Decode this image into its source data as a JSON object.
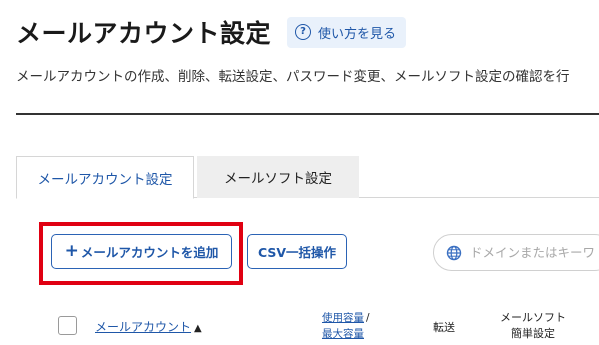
{
  "header": {
    "title": "メールアカウント設定",
    "help_label": "使い方を見る",
    "help_icon": "?",
    "description": "メールアカウントの作成、削除、転送設定、パスワード変更、メールソフト設定の確認を行"
  },
  "tabs": [
    {
      "label": "メールアカウント設定",
      "active": true
    },
    {
      "label": "メールソフト設定",
      "active": false
    }
  ],
  "toolbar": {
    "add_plus": "+",
    "add_label": "メールアカウントを追加",
    "csv_label": "CSV一括操作",
    "search_placeholder": "ドメインまたはキーワ"
  },
  "table": {
    "col_account": "メールアカウント",
    "sort_indicator": "▲",
    "col_usage_line1": "使用容量",
    "col_usage_sep": "/",
    "col_usage_line2": "最大容量",
    "col_forward": "転送",
    "col_mailsoft_line1": "メールソフト",
    "col_mailsoft_line2": "簡単設定"
  },
  "colors": {
    "accent": "#1f57a8",
    "highlight": "#e00012",
    "help_bg": "#e9f1fb",
    "inactive_tab_bg": "#eeeeee"
  },
  "icons": {
    "help": "help-circle-icon",
    "plus": "plus-icon",
    "globe": "globe-icon",
    "sort": "sort-up-icon"
  }
}
